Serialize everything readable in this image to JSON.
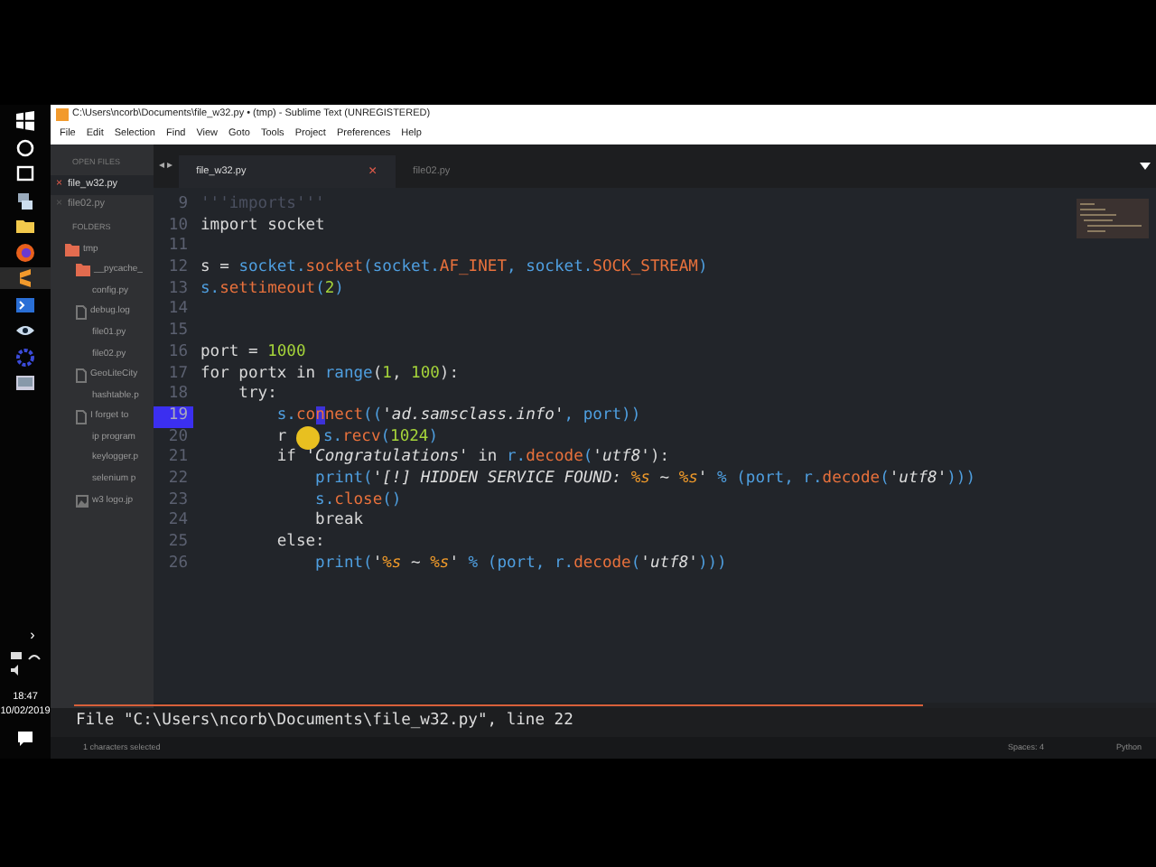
{
  "window": {
    "title": "C:\\Users\\ncorb\\Documents\\file_w32.py • (tmp) - Sublime Text (UNREGISTERED)"
  },
  "menu": [
    "File",
    "Edit",
    "Selection",
    "Find",
    "View",
    "Goto",
    "Tools",
    "Project",
    "Preferences",
    "Help"
  ],
  "taskbar": {
    "tray": {
      "chevron": "›",
      "time": "18:47",
      "date": "10/02/2019"
    }
  },
  "sidebar": {
    "open_files_header": "OPEN FILES",
    "open_files": [
      {
        "name": "file_w32.py",
        "selected": true,
        "close": "×"
      },
      {
        "name": "file02.py",
        "selected": false,
        "close": "×"
      }
    ],
    "folders_header": "FOLDERS",
    "tree": [
      {
        "name": "tmp",
        "kind": "folder",
        "children": [
          {
            "name": "__pycache_",
            "kind": "folder"
          },
          {
            "name": "config.py",
            "kind": "none"
          },
          {
            "name": "debug.log",
            "kind": "file"
          },
          {
            "name": "file01.py",
            "kind": "none"
          },
          {
            "name": "file02.py",
            "kind": "none"
          },
          {
            "name": "GeoLiteCity",
            "kind": "file"
          },
          {
            "name": "hashtable.p",
            "kind": "none"
          },
          {
            "name": "I forget to",
            "kind": "file"
          },
          {
            "name": "ip program",
            "kind": "none"
          },
          {
            "name": "keylogger.p",
            "kind": "none"
          },
          {
            "name": "selenium p",
            "kind": "none"
          },
          {
            "name": "w3 logo.jp",
            "kind": "image"
          }
        ]
      }
    ]
  },
  "tab_arrows": "◂ ▸",
  "tabs": [
    {
      "label": "file_w32.py",
      "selected": true,
      "close": "×"
    },
    {
      "label": "file02.py",
      "selected": false
    }
  ],
  "code": [
    {
      "number": "9",
      "current": false,
      "tokens": [
        {
          "t": "'''imports'''",
          "kind": "comment"
        }
      ]
    },
    {
      "number": "10",
      "current": false,
      "tokens": [
        {
          "t": "import socket",
          "kind": "plain"
        }
      ]
    },
    {
      "number": "11",
      "current": false
    },
    {
      "number": "12",
      "current": false,
      "tokens": [
        {
          "t": "s = ",
          "kind": "plain"
        },
        {
          "t": "socket.",
          "kind": "mod"
        },
        {
          "t": "socket",
          "kind": "fn"
        },
        {
          "t": "(socket.",
          "kind": "mod"
        },
        {
          "t": "AF_INET",
          "kind": "fn"
        },
        {
          "t": ", socket.",
          "kind": "mod"
        },
        {
          "t": "SOCK_STREAM",
          "kind": "fn"
        },
        {
          "t": ")",
          "kind": "mod"
        }
      ]
    },
    {
      "number": "13",
      "current": false,
      "tokens": [
        {
          "t": "s.",
          "kind": "mod"
        },
        {
          "t": "settimeout",
          "kind": "fn"
        },
        {
          "t": "(",
          "kind": "mod"
        },
        {
          "t": "2",
          "kind": "num"
        },
        {
          "t": ")",
          "kind": "mod"
        }
      ]
    },
    {
      "number": "14",
      "current": false
    },
    {
      "number": "15",
      "current": false
    },
    {
      "number": "16",
      "current": false,
      "tokens": [
        {
          "t": "port = ",
          "kind": "plain"
        },
        {
          "t": "1000",
          "kind": "num"
        }
      ]
    },
    {
      "number": "17",
      "current": false,
      "tokens": [
        {
          "t": "for portx in ",
          "kind": "plain"
        },
        {
          "t": "range",
          "kind": "mod"
        },
        {
          "t": "(",
          "kind": "plain"
        },
        {
          "t": "1",
          "kind": "num"
        },
        {
          "t": ", ",
          "kind": "plain"
        },
        {
          "t": "100",
          "kind": "num"
        },
        {
          "t": "):",
          "kind": "plain"
        }
      ]
    },
    {
      "number": "18",
      "current": false,
      "tokens": [
        {
          "t": "    try:",
          "kind": "plain"
        }
      ]
    },
    {
      "number": "19",
      "current": true,
      "tokens": [
        {
          "t": "        s.",
          "kind": "mod"
        },
        {
          "t": "co",
          "kind": "fn"
        },
        {
          "t": "n",
          "kind": "sel"
        },
        {
          "t": "nect",
          "kind": "fn"
        },
        {
          "t": "((",
          "kind": "mod"
        },
        {
          "t": "'ad.samsclass.info'",
          "kind": "str"
        },
        {
          "t": ", port))",
          "kind": "mod"
        }
      ]
    },
    {
      "number": "20",
      "current": false,
      "tokens": [
        {
          "t": "        r ",
          "kind": "plain"
        },
        {
          "kind": "pointer"
        },
        {
          "t": "s.",
          "kind": "mod"
        },
        {
          "t": "recv",
          "kind": "fn"
        },
        {
          "t": "(",
          "kind": "mod"
        },
        {
          "t": "1024",
          "kind": "num"
        },
        {
          "t": ")",
          "kind": "mod"
        }
      ]
    },
    {
      "number": "21",
      "current": false,
      "tokens": [
        {
          "t": "        if ",
          "kind": "plain"
        },
        {
          "t": "'Congratulations'",
          "kind": "str"
        },
        {
          "t": " in ",
          "kind": "plain"
        },
        {
          "t": "r.",
          "kind": "mod"
        },
        {
          "t": "decode",
          "kind": "fn"
        },
        {
          "t": "(",
          "kind": "mod"
        },
        {
          "t": "'utf8'",
          "kind": "str"
        },
        {
          "t": "):",
          "kind": "plain"
        }
      ]
    },
    {
      "number": "22",
      "current": false,
      "tokens": [
        {
          "t": "            print(",
          "kind": "mod"
        },
        {
          "t": "'[!] HIDDEN SERVICE FOUND: ",
          "kind": "str"
        },
        {
          "t": "%s",
          "kind": "fmt"
        },
        {
          "t": " ~ ",
          "kind": "str"
        },
        {
          "t": "%s",
          "kind": "fmt"
        },
        {
          "t": "'",
          "kind": "str"
        },
        {
          "t": " % (port, r.",
          "kind": "mod"
        },
        {
          "t": "decode",
          "kind": "fn"
        },
        {
          "t": "(",
          "kind": "mod"
        },
        {
          "t": "'utf8'",
          "kind": "str"
        },
        {
          "t": ")))",
          "kind": "mod"
        }
      ]
    },
    {
      "number": "23",
      "current": false,
      "tokens": [
        {
          "t": "            s.",
          "kind": "mod"
        },
        {
          "t": "close",
          "kind": "fn"
        },
        {
          "t": "()",
          "kind": "mod"
        }
      ]
    },
    {
      "number": "24",
      "current": false,
      "tokens": [
        {
          "t": "            break",
          "kind": "plain"
        }
      ]
    },
    {
      "number": "25",
      "current": false,
      "tokens": [
        {
          "t": "        else:",
          "kind": "plain"
        }
      ]
    },
    {
      "number": "26",
      "current": false,
      "tokens": [
        {
          "t": "            print(",
          "kind": "mod"
        },
        {
          "t": "'",
          "kind": "str"
        },
        {
          "t": "%s",
          "kind": "fmt"
        },
        {
          "t": " ~ ",
          "kind": "str"
        },
        {
          "t": "%s",
          "kind": "fmt"
        },
        {
          "t": "'",
          "kind": "str"
        },
        {
          "t": " % (port, r.",
          "kind": "mod"
        },
        {
          "t": "decode",
          "kind": "fn"
        },
        {
          "t": "(",
          "kind": "mod"
        },
        {
          "t": "'utf8'",
          "kind": "str"
        },
        {
          "t": ")))",
          "kind": "mod"
        }
      ]
    }
  ],
  "console": "File \"C:\\Users\\ncorb\\Documents\\file_w32.py\", line 22",
  "status_bar": {
    "selection": "1 characters selected",
    "indent": "Spaces: 4",
    "syntax": "Python"
  }
}
